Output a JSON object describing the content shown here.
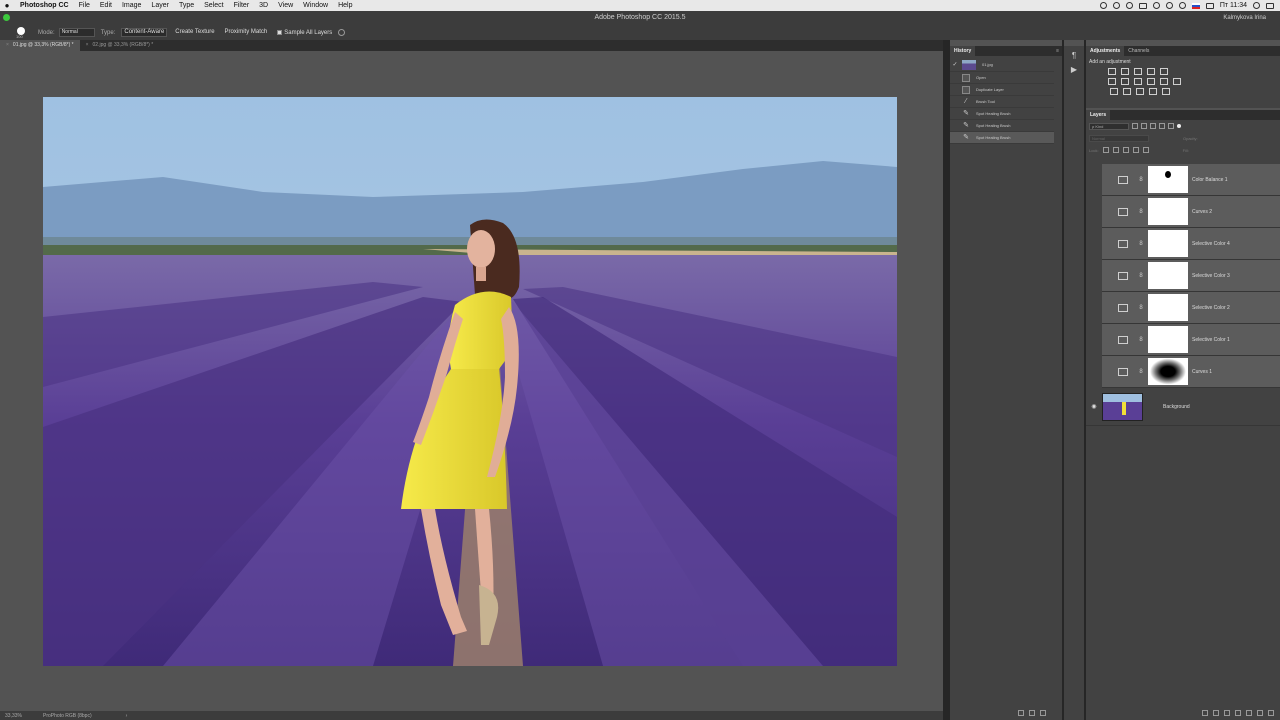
{
  "menubar": {
    "apple": "",
    "app_name": "Photoshop CC",
    "items": [
      "File",
      "Edit",
      "Image",
      "Layer",
      "Type",
      "Select",
      "Filter",
      "3D",
      "View",
      "Window",
      "Help"
    ],
    "clock": "Пт 11:34"
  },
  "window": {
    "title": "Adobe Photoshop CC 2015.5",
    "user": "Kalmykova Irina"
  },
  "options": {
    "brush_size": "100",
    "mode_label": "Mode:",
    "mode_value": "Normal",
    "type_label": "Type:",
    "type_options": [
      "Content-Aware",
      "Create Texture",
      "Proximity Match"
    ],
    "active_type": "Content-Aware",
    "sample_all_layers": "Sample All Layers"
  },
  "tabs": [
    {
      "label": "01.jpg @ 33,3% (RGB/8*) *",
      "active": true
    },
    {
      "label": "02.jpg @ 33,3% (RGB/8*) *",
      "active": false
    }
  ],
  "status": {
    "zoom": "33,33%",
    "profile": "ProPhoto RGB (8bpc)",
    "arrow": "›"
  },
  "history": {
    "tab": "History",
    "snapshot": "01.jpg",
    "items": [
      "Open",
      "Duplicate Layer",
      "Brush Tool",
      "Spot Healing Brush",
      "Spot Healing Brush",
      "Spot Healing Brush"
    ],
    "selected_index": 5
  },
  "adjustments": {
    "tabs": [
      "Adjustments",
      "Channels"
    ],
    "title": "Add an adjustment"
  },
  "layers": {
    "tab": "Layers",
    "kind": "ρ Kind",
    "blend": "Normal",
    "opacity_label": "Opacity:",
    "lock_label": "Lock:",
    "fill_label": "Fill:",
    "items": [
      {
        "name": "Color Balance 1",
        "mask": "spot"
      },
      {
        "name": "Curves 2",
        "mask": "white"
      },
      {
        "name": "Selective Color 4",
        "mask": "white"
      },
      {
        "name": "Selective Color 3",
        "mask": "white"
      },
      {
        "name": "Selective Color 2",
        "mask": "white"
      },
      {
        "name": "Selective Color 1",
        "mask": "white"
      },
      {
        "name": "Curves 1",
        "mask": "vignette"
      }
    ],
    "background": "Background"
  },
  "colors": {
    "panel": "#424242",
    "canvas": "#535353",
    "dress": "#f2e037",
    "lavender": "#5a3e96",
    "sky": "#8fb4d6"
  }
}
